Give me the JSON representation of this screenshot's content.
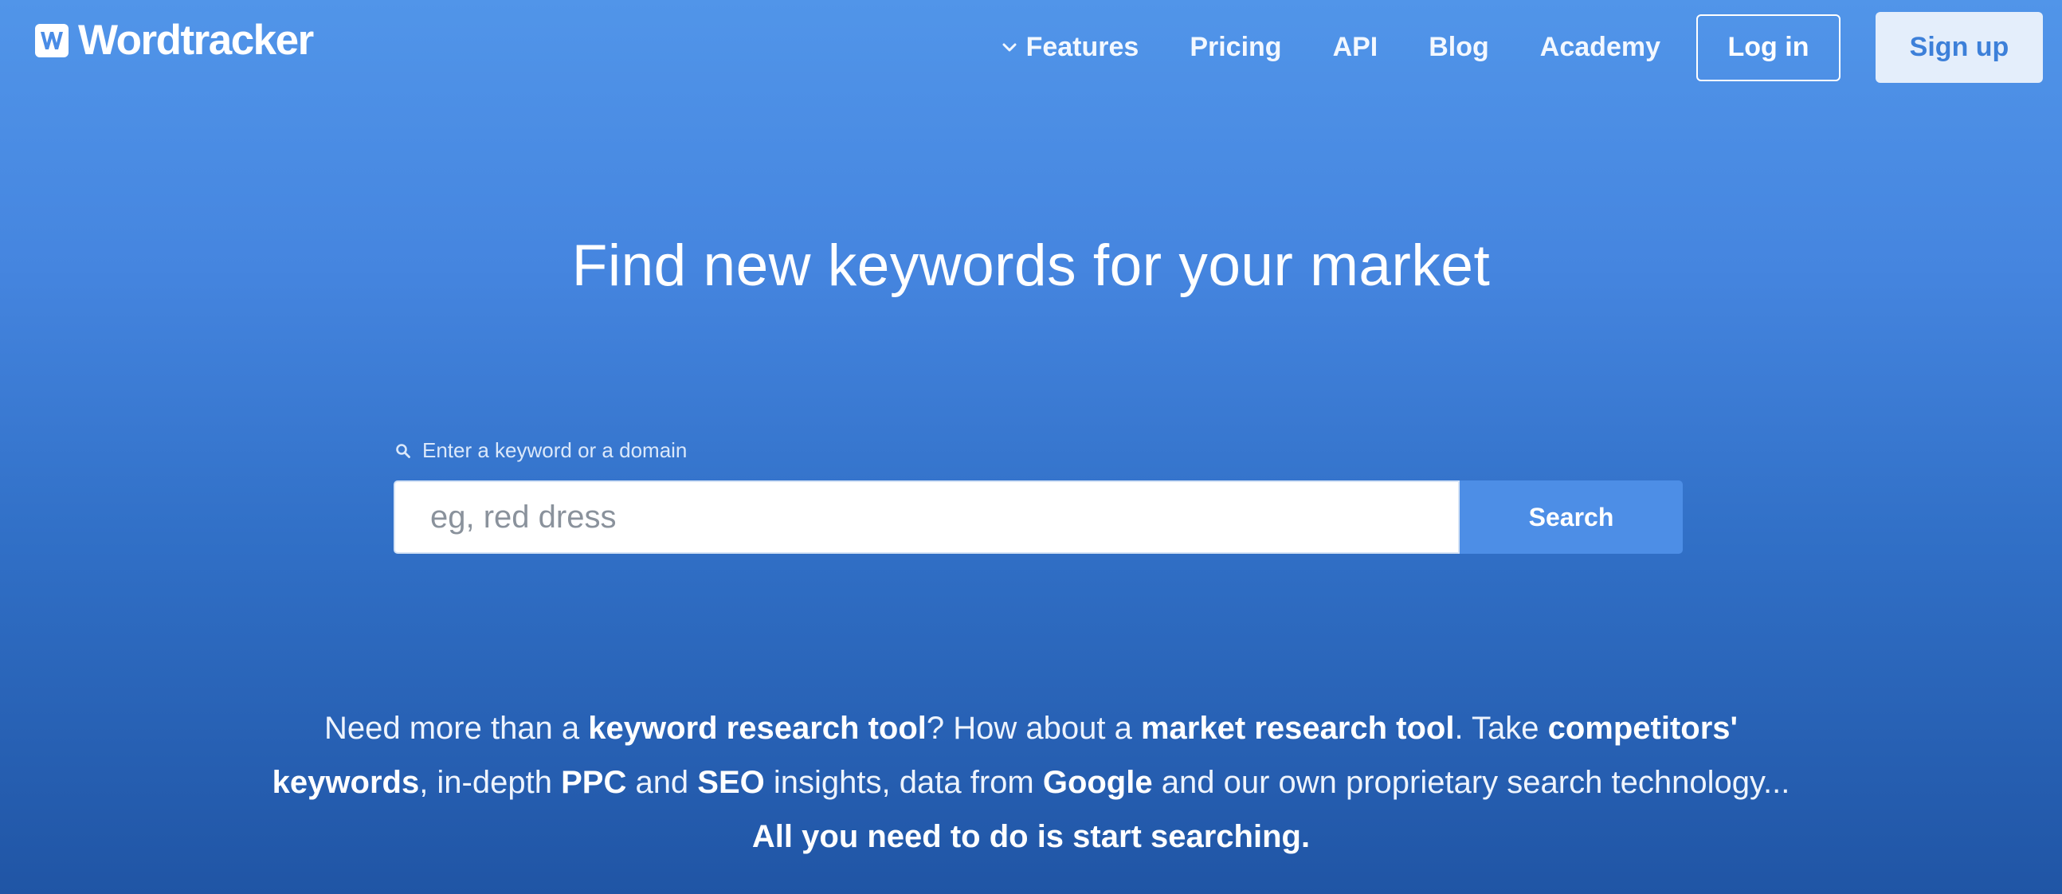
{
  "header": {
    "logo_mark": "W",
    "logo_text": "Wordtracker",
    "nav": {
      "features": "Features",
      "pricing": "Pricing",
      "api": "API",
      "blog": "Blog",
      "academy": "Academy"
    },
    "login_label": "Log in",
    "signup_label": "Sign up"
  },
  "hero": {
    "title": "Find new keywords for your market",
    "search": {
      "label": "Enter a keyword or a domain",
      "value": "",
      "placeholder": "eg, red dress",
      "button_label": "Search"
    }
  },
  "blurb": {
    "p1": "Need more than a ",
    "b1": "keyword research tool",
    "p2": "? How about a ",
    "b2": "market research tool",
    "p3": ". Take ",
    "b3": "competitors' keywords",
    "p4": ", in-depth ",
    "b4": "PPC",
    "p5": " and ",
    "b5": "SEO",
    "p6": " insights, data from ",
    "b6": "Google",
    "p7": " and our own proprietary search technology... ",
    "b7": "All you need to do is start searching."
  },
  "colors": {
    "background_top": "#5195e9",
    "background_bottom": "#2055a5",
    "search_button": "#4d8ee6",
    "signup_bg": "#e4eefb",
    "signup_text": "#3d80d9"
  },
  "icons": {
    "logo": "wordtracker-logo-icon",
    "features_chevron": "chevron-down-icon",
    "search": "search-icon"
  }
}
